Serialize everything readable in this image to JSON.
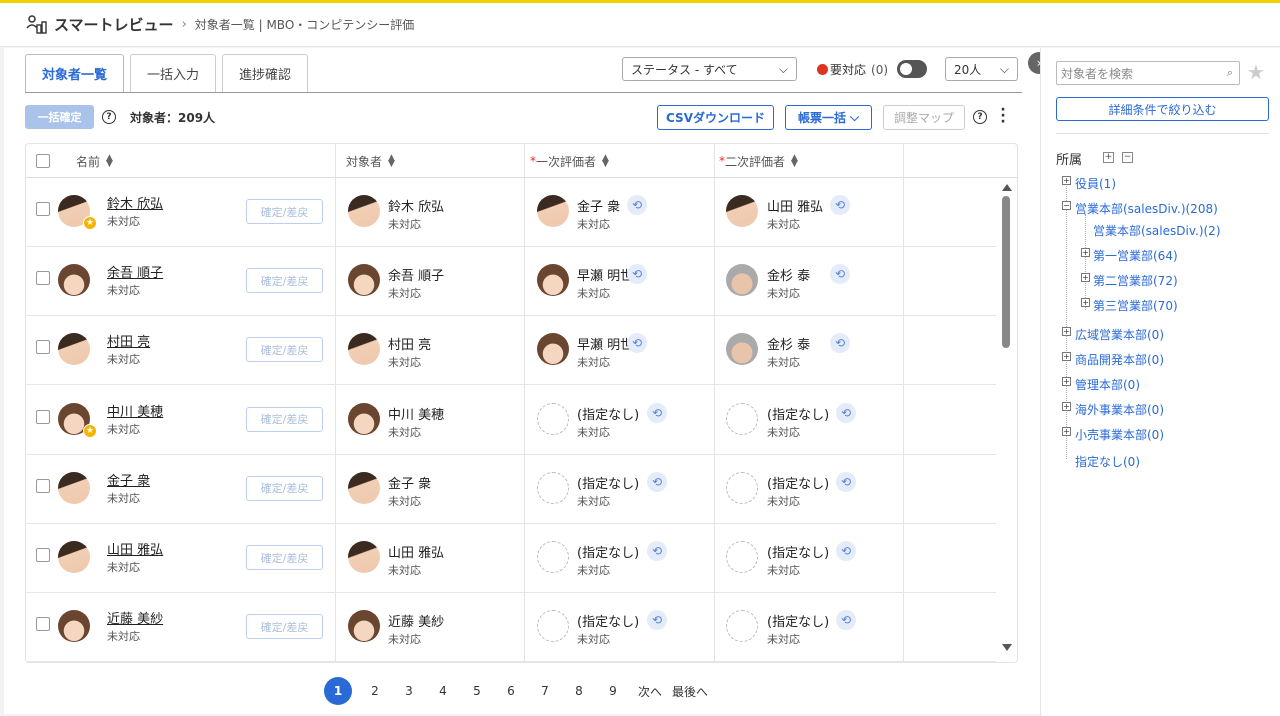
{
  "header": {
    "app_title": "スマートレビュー",
    "breadcrumb": "対象者一覧 | MBO・コンピテンシー評価"
  },
  "tabs": [
    {
      "label": "対象者一覧",
      "active": true
    },
    {
      "label": "一括入力",
      "active": false
    },
    {
      "label": "進捗確認",
      "active": false
    }
  ],
  "filters": {
    "status_label": "ステータス - すべて",
    "alert_label": "要対応",
    "alert_count": "(0)",
    "per_page": "20人"
  },
  "toolbar": {
    "bulk_confirm": "一括確定",
    "count_label": "対象者：209人",
    "csv_download": "CSVダウンロード",
    "forms_bulk": "帳票一括",
    "adjust_map": "調整マップ"
  },
  "table": {
    "headers": {
      "name": "名前",
      "target": "対象者",
      "req_mark": "*",
      "first_eval": "一次評価者",
      "second_eval": "二次評価者"
    },
    "confirm_label": "確定/差戻",
    "rows": [
      {
        "name": "鈴木 欣弘",
        "status": "未対応",
        "star": true,
        "target": "鈴木 欣弘",
        "target_status": "未対応",
        "first": "金子 衆",
        "first_status": "未対応",
        "second": "山田 雅弘",
        "second_status": "未対応"
      },
      {
        "name": "余吾 順子",
        "status": "未対応",
        "star": false,
        "target": "余吾 順子",
        "target_status": "未対応",
        "first": "早瀬 明世",
        "first_status": "未対応",
        "second": "金杉 泰",
        "second_status": "未対応"
      },
      {
        "name": "村田 亮",
        "status": "未対応",
        "star": false,
        "target": "村田 亮",
        "target_status": "未対応",
        "first": "早瀬 明世",
        "first_status": "未対応",
        "second": "金杉 泰",
        "second_status": "未対応"
      },
      {
        "name": "中川 美穂",
        "status": "未対応",
        "star": true,
        "target": "中川 美穂",
        "target_status": "未対応",
        "first": "(指定なし)",
        "first_status": "未対応",
        "second": "(指定なし)",
        "second_status": "未対応"
      },
      {
        "name": "金子 衆",
        "status": "未対応",
        "star": false,
        "target": "金子 衆",
        "target_status": "未対応",
        "first": "(指定なし)",
        "first_status": "未対応",
        "second": "(指定なし)",
        "second_status": "未対応"
      },
      {
        "name": "山田 雅弘",
        "status": "未対応",
        "star": false,
        "target": "山田 雅弘",
        "target_status": "未対応",
        "first": "(指定なし)",
        "first_status": "未対応",
        "second": "(指定なし)",
        "second_status": "未対応"
      },
      {
        "name": "近藤 美紗",
        "status": "未対応",
        "star": false,
        "target": "近藤 美紗",
        "target_status": "未対応",
        "first": "(指定なし)",
        "first_status": "未対応",
        "second": "(指定なし)",
        "second_status": "未対応"
      }
    ]
  },
  "pagination": {
    "pages": [
      "1",
      "2",
      "3",
      "4",
      "5",
      "6",
      "7",
      "8",
      "9"
    ],
    "current": "1",
    "next": "次へ",
    "last": "最後へ"
  },
  "sidebar": {
    "search_placeholder": "対象者を検索",
    "filter_button": "詳細条件で絞り込む",
    "tree_title": "所属",
    "nodes": [
      "役員(1)",
      "営業本部(salesDiv.)(208)",
      "営業本部(salesDiv.)(2)",
      "第一営業部(64)",
      "第二営業部(72)",
      "第三営業部(70)",
      "広域営業本部(0)",
      "商品開発本部(0)",
      "管理本部(0)",
      "海外事業本部(0)",
      "小売事業本部(0)",
      "指定なし(0)"
    ]
  },
  "colors": {
    "accent": "#2a6ad6",
    "top_bar": "#f5d000",
    "alert": "#d32222"
  }
}
